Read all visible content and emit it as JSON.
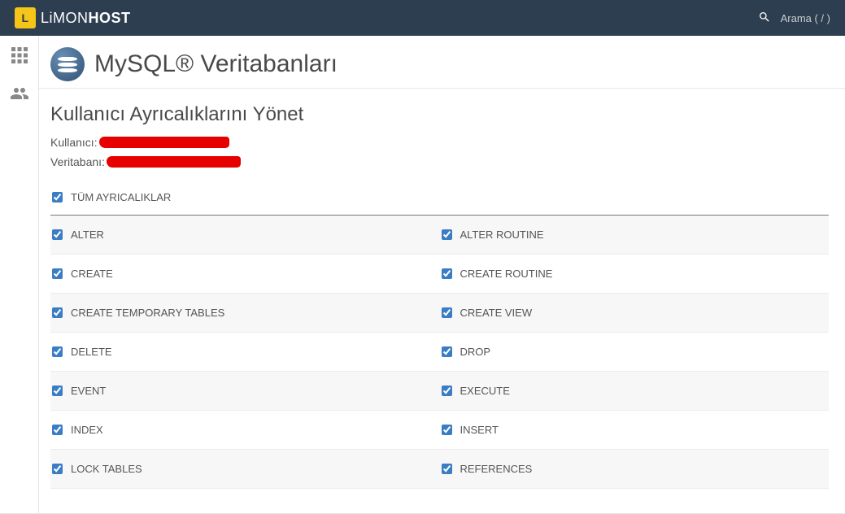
{
  "brand": {
    "text_thin": "LiMON",
    "text_bold": "HOST"
  },
  "search": {
    "placeholder": "Arama ( / )"
  },
  "page": {
    "title": "MySQL® Veritabanları",
    "section_title": "Kullanıcı Ayrıcalıklarını Yönet",
    "user_label": "Kullanıcı:",
    "db_label": "Veritabanı:",
    "all_priv_label": "TÜM AYRICALIKLAR"
  },
  "privileges": [
    {
      "left": "ALTER",
      "right": "ALTER ROUTINE"
    },
    {
      "left": "CREATE",
      "right": "CREATE ROUTINE"
    },
    {
      "left": "CREATE TEMPORARY TABLES",
      "right": "CREATE VIEW"
    },
    {
      "left": "DELETE",
      "right": "DROP"
    },
    {
      "left": "EVENT",
      "right": "EXECUTE"
    },
    {
      "left": "INDEX",
      "right": "INSERT"
    },
    {
      "left": "LOCK TABLES",
      "right": "REFERENCES"
    }
  ]
}
